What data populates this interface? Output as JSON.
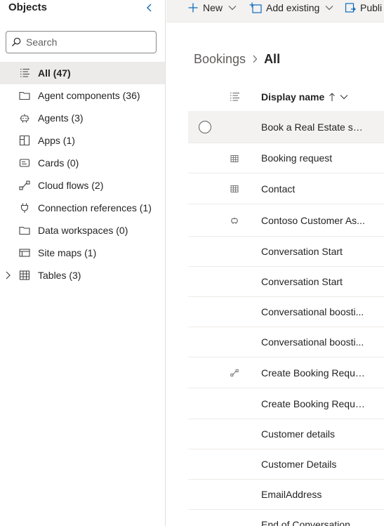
{
  "left_panel": {
    "title": "Objects",
    "search_placeholder": "Search",
    "items": [
      {
        "label": "All",
        "count": "(47)",
        "text": "All  (47)",
        "icon": "list-icon",
        "selected": true
      },
      {
        "label": "Agent components",
        "count": "(36)",
        "text": "Agent components  (36)",
        "icon": "folder-icon"
      },
      {
        "label": "Agents",
        "count": "(3)",
        "text": "Agents  (3)",
        "icon": "bot-icon"
      },
      {
        "label": "Apps",
        "count": "(1)",
        "text": "Apps  (1)",
        "icon": "apps-icon"
      },
      {
        "label": "Cards",
        "count": "(0)",
        "text": "Cards  (0)",
        "icon": "card-icon"
      },
      {
        "label": "Cloud flows",
        "count": "(2)",
        "text": "Cloud flows  (2)",
        "icon": "flow-icon"
      },
      {
        "label": "Connection references",
        "count": "(1)",
        "text": "Connection references  (1)",
        "icon": "plug-icon"
      },
      {
        "label": "Data workspaces",
        "count": "(0)",
        "text": "Data workspaces  (0)",
        "icon": "folder-icon"
      },
      {
        "label": "Site maps",
        "count": "(1)",
        "text": "Site maps  (1)",
        "icon": "sitemap-icon"
      },
      {
        "label": "Tables",
        "count": "(3)",
        "text": "Tables  (3)",
        "icon": "table-icon",
        "expandable": true
      }
    ]
  },
  "command_bar": {
    "new_label": "New",
    "add_existing_label": "Add existing",
    "publish_label": "Publi"
  },
  "breadcrumb": {
    "root": "Bookings",
    "current": "All"
  },
  "grid": {
    "header": {
      "display_name": "Display name"
    },
    "rows": [
      {
        "name": "Book a Real Estate sho...",
        "icon": "",
        "hovered": true
      },
      {
        "name": "Booking request",
        "icon": "table-icon"
      },
      {
        "name": "Contact",
        "icon": "table-icon"
      },
      {
        "name": "Contoso Customer As...",
        "icon": "bot-icon"
      },
      {
        "name": "Conversation Start",
        "icon": ""
      },
      {
        "name": "Conversation Start",
        "icon": ""
      },
      {
        "name": "Conversational boosti...",
        "icon": ""
      },
      {
        "name": "Conversational boosti...",
        "icon": ""
      },
      {
        "name": "Create Booking Request",
        "icon": "flow-icon"
      },
      {
        "name": "Create Booking Request",
        "icon": ""
      },
      {
        "name": "Customer details",
        "icon": ""
      },
      {
        "name": "Customer Details",
        "icon": ""
      },
      {
        "name": "EmailAddress",
        "icon": ""
      },
      {
        "name": "End of Conversation",
        "icon": ""
      }
    ]
  },
  "colors": {
    "accent": "#0f6cbd",
    "selected_bg": "#edebe9",
    "command_bar_bg": "#f3f2f1"
  }
}
